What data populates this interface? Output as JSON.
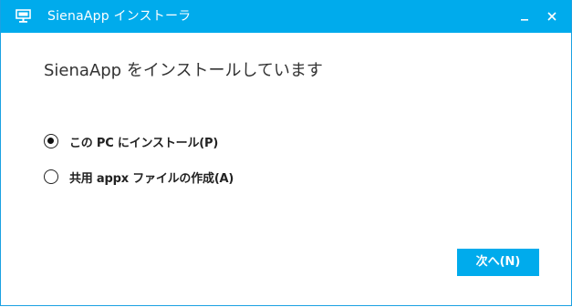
{
  "window": {
    "title": "SienaApp インストーラ",
    "controls": {
      "minimize_icon": "minimize-icon",
      "close_icon": "close-icon"
    },
    "accent_color": "#00abec"
  },
  "main": {
    "heading": "SienaApp をインストールしています",
    "options": [
      {
        "label": "この PC にインストール(P)",
        "selected": true
      },
      {
        "label": "共用 appx ファイルの作成(A)",
        "selected": false
      }
    ]
  },
  "footer": {
    "next_label": "次へ(N)"
  }
}
